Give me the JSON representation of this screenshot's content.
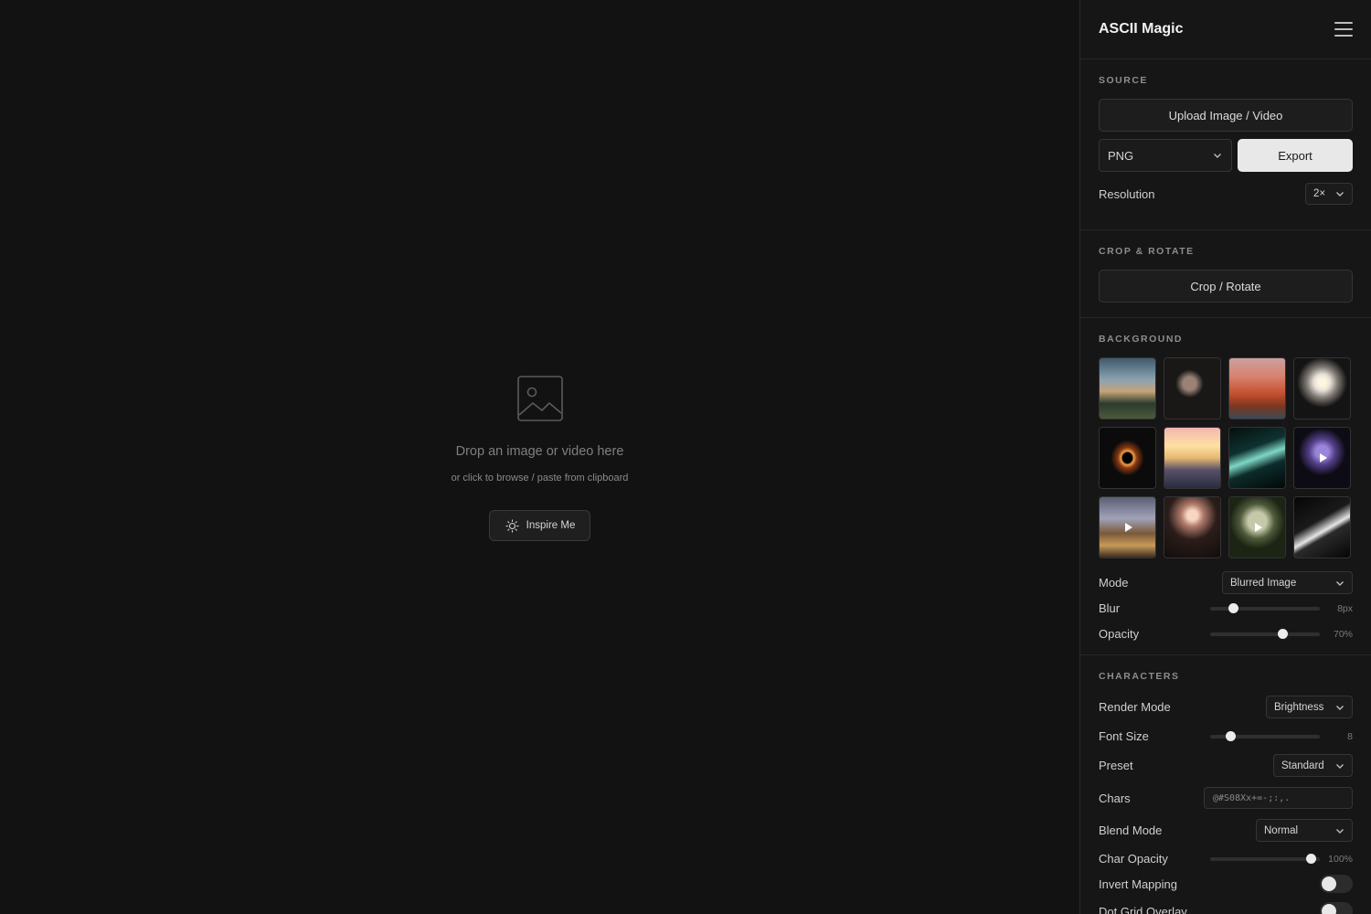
{
  "canvas": {
    "drop_title": "Drop an image or video here",
    "drop_subtitle": "or click to browse / paste from clipboard",
    "inspire_label": "Inspire Me"
  },
  "panel": {
    "title": "ASCII Magic",
    "source": {
      "heading": "SOURCE",
      "upload_label": "Upload Image / Video",
      "format_value": "PNG",
      "export_label": "Export",
      "resolution_label": "Resolution",
      "resolution_value": "2×"
    },
    "crop": {
      "heading": "CROP & ROTATE",
      "button_label": "Crop / Rotate"
    },
    "background": {
      "heading": "BACKGROUND",
      "thumbnails": [
        {
          "name": "landscape-clouds",
          "video": false
        },
        {
          "name": "portrait-woman",
          "video": false
        },
        {
          "name": "red-mountains",
          "video": false
        },
        {
          "name": "white-flower",
          "video": false
        },
        {
          "name": "black-hole",
          "video": false
        },
        {
          "name": "sunset-forest",
          "video": false
        },
        {
          "name": "green-waves",
          "video": false
        },
        {
          "name": "purple-flower",
          "video": true
        },
        {
          "name": "mountain-valley",
          "video": true
        },
        {
          "name": "glowing-flower",
          "video": false
        },
        {
          "name": "moon-mountains",
          "video": true
        },
        {
          "name": "dark-curve",
          "video": false
        }
      ],
      "mode_label": "Mode",
      "mode_value": "Blurred Image",
      "blur_label": "Blur",
      "blur_value": "8px",
      "blur_fraction": 0.18,
      "opacity_label": "Opacity",
      "opacity_value": "70%",
      "opacity_fraction": 0.68
    },
    "characters": {
      "heading": "CHARACTERS",
      "render_mode_label": "Render Mode",
      "render_mode_value": "Brightness",
      "font_size_label": "Font Size",
      "font_size_value": "8",
      "font_size_fraction": 0.16,
      "preset_label": "Preset",
      "preset_value": "Standard",
      "chars_label": "Chars",
      "chars_value": "@#S08Xx+=-;:,.",
      "blend_label": "Blend Mode",
      "blend_value": "Normal",
      "char_opacity_label": "Char Opacity",
      "char_opacity_value": "100%",
      "char_opacity_fraction": 0.96,
      "invert_label": "Invert Mapping",
      "invert_on": false,
      "dot_grid_label": "Dot Grid Overlay",
      "dot_grid_on": false
    }
  },
  "colors": {
    "background": "#121212",
    "panel": "#161616",
    "export_button": "#e8e8e8"
  }
}
